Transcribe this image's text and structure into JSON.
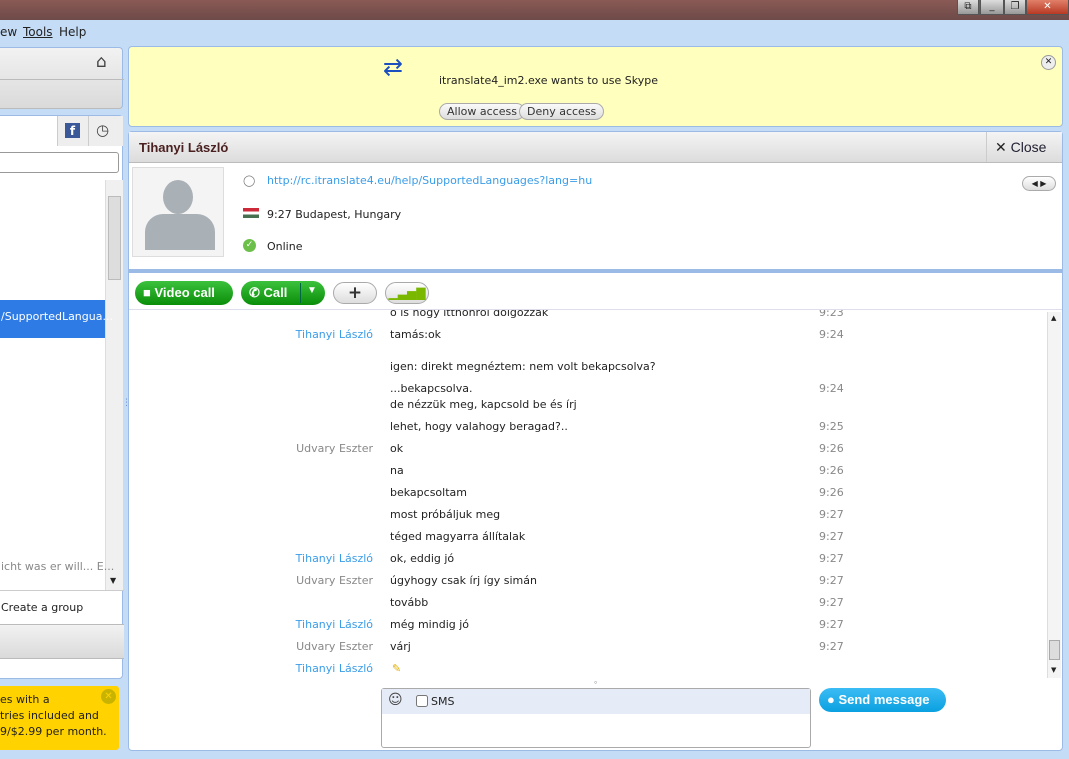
{
  "window": {
    "controls": [
      "restore-alt",
      "minimize",
      "maximize",
      "close"
    ]
  },
  "menu": [
    "ew",
    "Tools",
    "Help"
  ],
  "sidebar": {
    "selected_item": "/SupportedLangua...",
    "mood_item": "icht was er will... E...",
    "create_group": "Create a group",
    "promo": [
      "es with a",
      "tries included and",
      "9/$2.99 per month."
    ]
  },
  "notification": {
    "text": "itranslate4_im2.exe wants to use Skype",
    "allow": "Allow access",
    "deny": "Deny access"
  },
  "contact": {
    "name": "Tihanyi László",
    "close": "Close",
    "mood_link": "http://rc.itranslate4.eu/help/SupportedLanguages?lang=hu",
    "local_time": "9:27 Budapest, Hungary",
    "status": "Online",
    "status_color": "#6cc04a"
  },
  "toolbar": {
    "video_call": "Video call",
    "call": "Call"
  },
  "messages": [
    {
      "sender": "",
      "text": "ő is hogy itthonról dolgozzák",
      "time": "9:23"
    },
    {
      "sender": "Tihanyi László",
      "text": "tamás:ok",
      "time": "9:24"
    },
    {
      "sender": "",
      "text": "igen: direkt megnéztem: nem volt bekapcsolva?",
      "time": ""
    },
    {
      "sender": "",
      "text": "...bekapcsolva.",
      "time": "9:24"
    },
    {
      "sender": "",
      "text": "de nézzük meg, kapcsold be és írj",
      "time": ""
    },
    {
      "sender": "",
      "text": "lehet, hogy valahogy beragad?..",
      "time": "9:25"
    },
    {
      "sender": "Udvary Eszter",
      "text": "ok",
      "time": "9:26"
    },
    {
      "sender": "",
      "text": "na",
      "time": "9:26"
    },
    {
      "sender": "",
      "text": "bekapcsoltam",
      "time": "9:26"
    },
    {
      "sender": "",
      "text": "most próbáljuk meg",
      "time": "9:27"
    },
    {
      "sender": "",
      "text": "téged magyarra állítalak",
      "time": "9:27"
    },
    {
      "sender": "Tihanyi László",
      "text": "ok, eddig jó",
      "time": "9:27"
    },
    {
      "sender": "Udvary Eszter",
      "text": "úgyhogy csak írj így simán",
      "time": "9:27"
    },
    {
      "sender": "",
      "text": "tovább",
      "time": "9:27"
    },
    {
      "sender": "Tihanyi László",
      "text": "még mindig jó",
      "time": "9:27"
    },
    {
      "sender": "Udvary Eszter",
      "text": "várj",
      "time": "9:27"
    },
    {
      "sender": "Tihanyi László",
      "text": "",
      "time": "",
      "typing": true
    }
  ],
  "compose": {
    "sms_label": "SMS",
    "value": "",
    "send": "Send message"
  }
}
